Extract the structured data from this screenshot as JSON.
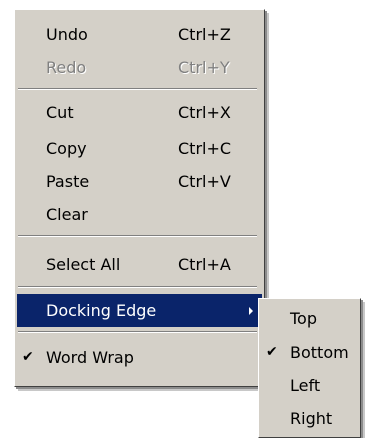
{
  "context_menu": {
    "undo": {
      "label": "Undo",
      "shortcut": "Ctrl+Z"
    },
    "redo": {
      "label": "Redo",
      "shortcut": "Ctrl+Y"
    },
    "cut": {
      "label": "Cut",
      "shortcut": "Ctrl+X"
    },
    "copy": {
      "label": "Copy",
      "shortcut": "Ctrl+C"
    },
    "paste": {
      "label": "Paste",
      "shortcut": "Ctrl+V"
    },
    "clear": {
      "label": "Clear"
    },
    "select_all": {
      "label": "Select All",
      "shortcut": "Ctrl+A"
    },
    "docking_edge": {
      "label": "Docking Edge"
    },
    "word_wrap": {
      "label": "Word Wrap",
      "check": "✔"
    }
  },
  "docking_submenu": {
    "top": {
      "label": "Top"
    },
    "bottom": {
      "label": "Bottom",
      "check": "✔"
    },
    "left": {
      "label": "Left"
    },
    "right": {
      "label": "Right"
    }
  },
  "colors": {
    "menu_bg": "#d4d0c8",
    "highlight_bg": "#0a246a",
    "disabled_text": "#808080"
  },
  "icons": {
    "checkmark": "checkmark-icon",
    "submenu_arrow": "submenu-arrow-icon"
  }
}
